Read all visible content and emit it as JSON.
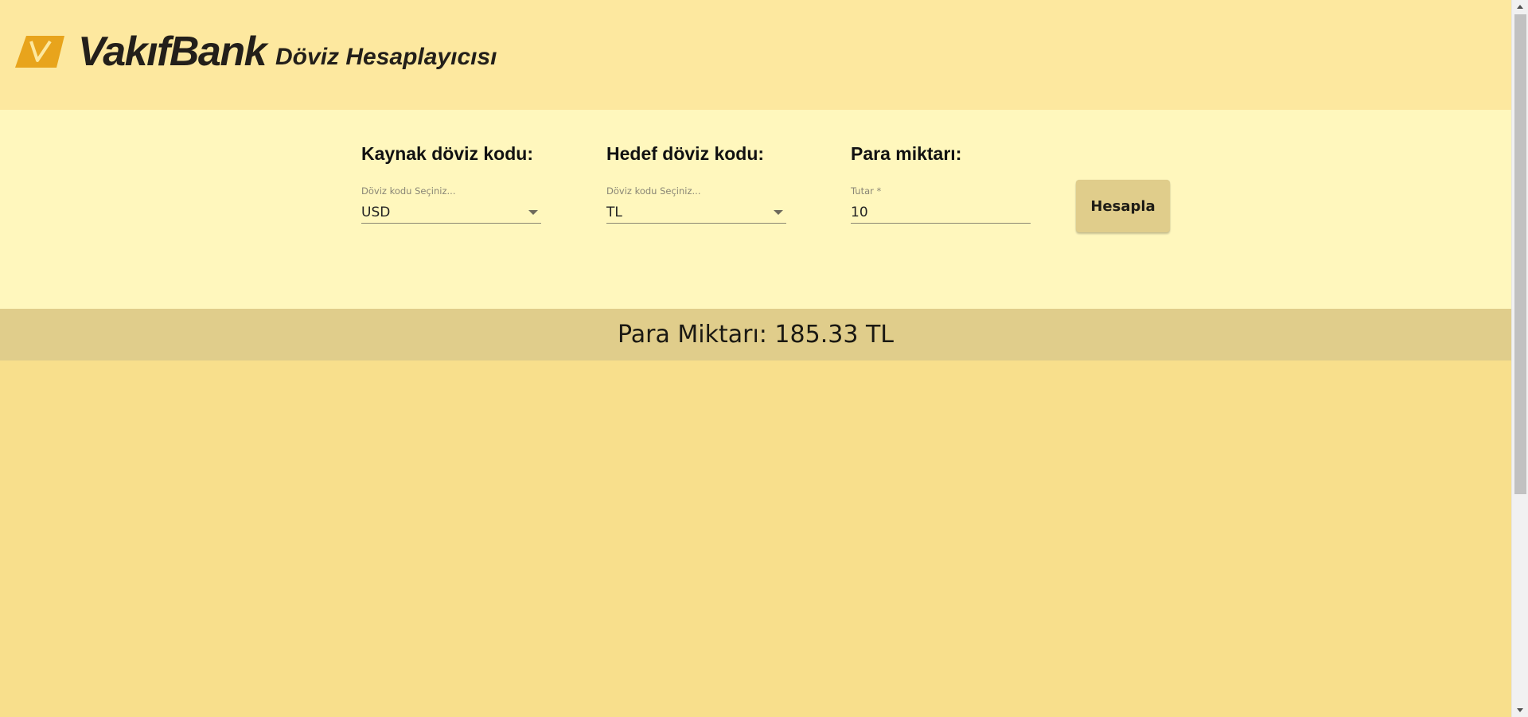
{
  "header": {
    "brand_name": "VakıfBank",
    "logo_icon": "vakifbank-v-logo-icon",
    "app_title": "Döviz Hesaplayıcısı"
  },
  "form": {
    "source": {
      "heading": "Kaynak döviz kodu:",
      "label": "Döviz kodu Seçiniz...",
      "value": "USD"
    },
    "target": {
      "heading": "Hedef döviz kodu:",
      "label": "Döviz kodu Seçiniz...",
      "value": "TL"
    },
    "amount": {
      "heading": "Para miktarı:",
      "label": "Tutar *",
      "value": "10"
    },
    "submit_label": "Hesapla"
  },
  "result": {
    "text": "Para Miktarı: 185.33 TL"
  },
  "colors": {
    "header_bg": "#fde89f",
    "form_bg": "#fff7bd",
    "result_bg": "#e0cd8b",
    "page_bg": "#f8df8c",
    "brand_orange": "#e8a41c"
  }
}
